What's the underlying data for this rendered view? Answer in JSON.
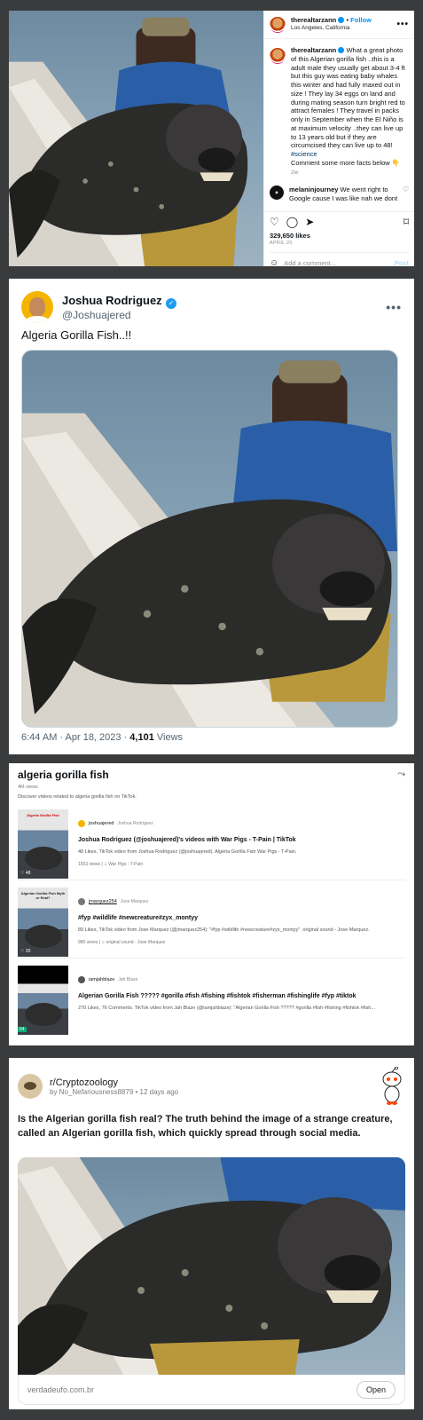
{
  "instagram": {
    "username": "therealtarzann",
    "follow": "Follow",
    "location": "Los Angeles, California",
    "more": "•••",
    "caption": "What a great photo of this Algerian gorilla fish ..this is a adult male they usually get about 3-4 ft but this guy was eating baby whales this winter and had fully maxed out in size ! They lay 34 eggs on land and during mating season turn bright red to attract females ! They travel in packs only in September when the El Niño is at maximum velocity ..they can live up to 13 years old but if they are circumcised they can live up to 48!",
    "hashtag": "#science",
    "caption_end": "Comment some more facts below 👇",
    "caption_time": "2w",
    "comment_user": "melaninjourney",
    "comment_text": "We went right to Google cause I was like nah we dont think this is real",
    "likes": "329,650 likes",
    "date": "APRIL 20",
    "add_comment_placeholder": "Add a comment...",
    "post_label": "Post"
  },
  "tweet": {
    "name": "Joshua Rodriguez",
    "handle": "@Joshuajered",
    "text": "Algeria Gorilla Fish..!!",
    "timestamp": "6:44 AM · Apr 18, 2023 · ",
    "views_count": "4,101",
    "views_label": " Views",
    "more": "•••"
  },
  "tiktok": {
    "title": "algeria gorilla fish",
    "views": "4M views",
    "subtitle": "Discover videos related to algeria gorilla fish on TikTok.",
    "results": [
      {
        "thumb_label": "Algeria Gorilla Fish",
        "thumb_count": "48",
        "user": "joshuajered",
        "nickname": "Joshua Rodriguez",
        "heading": "Joshua Rodriguez (@joshuajered)'s videos with War Pigs - T-Pain | TikTok",
        "description": "48 Likes, TikTok video from Joshua Rodriguez (@joshuajered). Algeria Gorilla Fish War Pigs - T-Pain.",
        "stats": "1553 views  |  ♫ War Pigs - T-Pain"
      },
      {
        "thumb_label": "Algerian Gorilla Fish Myth or Real?",
        "thumb_count": "20",
        "user": "jmarquez254",
        "nickname": "Jose Marquez",
        "heading": "#fyp #wildlife #newcreature#zyx_montyy",
        "description": "89 Likes, TikTok video from Jose Marquez (@jmarquez254): \"#fyp #wildlife #newcreature#zyx_montyy\". original sound - Jose Marquez.",
        "stats": "980 views  |  ♫ original sound - Jose Marquez"
      },
      {
        "thumb_label": "",
        "thumb_count": "54",
        "user": "iamjahblaze",
        "nickname": "Jah Blaze",
        "heading": "Algerian Gorilla Fish ????? #gorilla #fish #fishing #fishtok #fisherman #fishinglife #fyp #tiktok",
        "description": "270 Likes, 76 Comments. TikTok video from Jah Blaze (@iamjahblaze): \"Algerian Gorilla Fish ????? #gorilla #fish #fishing #fishtok #fish...",
        "stats": ""
      }
    ]
  },
  "reddit": {
    "subreddit": "r/Cryptozoology",
    "byline": "by No_Nefariousness8879 • 12 days ago",
    "title": "Is the Algerian gorilla fish real? The truth behind the image of a strange creature, called an Algerian gorilla fish, which quickly spread through social media.",
    "link_domain": "verdadeufo.com.br",
    "open_label": "Open"
  },
  "colors": {
    "twitter_blue": "#1d9bf0",
    "instagram_blue": "#0095f6",
    "page_bg": "#3a3b3c"
  }
}
